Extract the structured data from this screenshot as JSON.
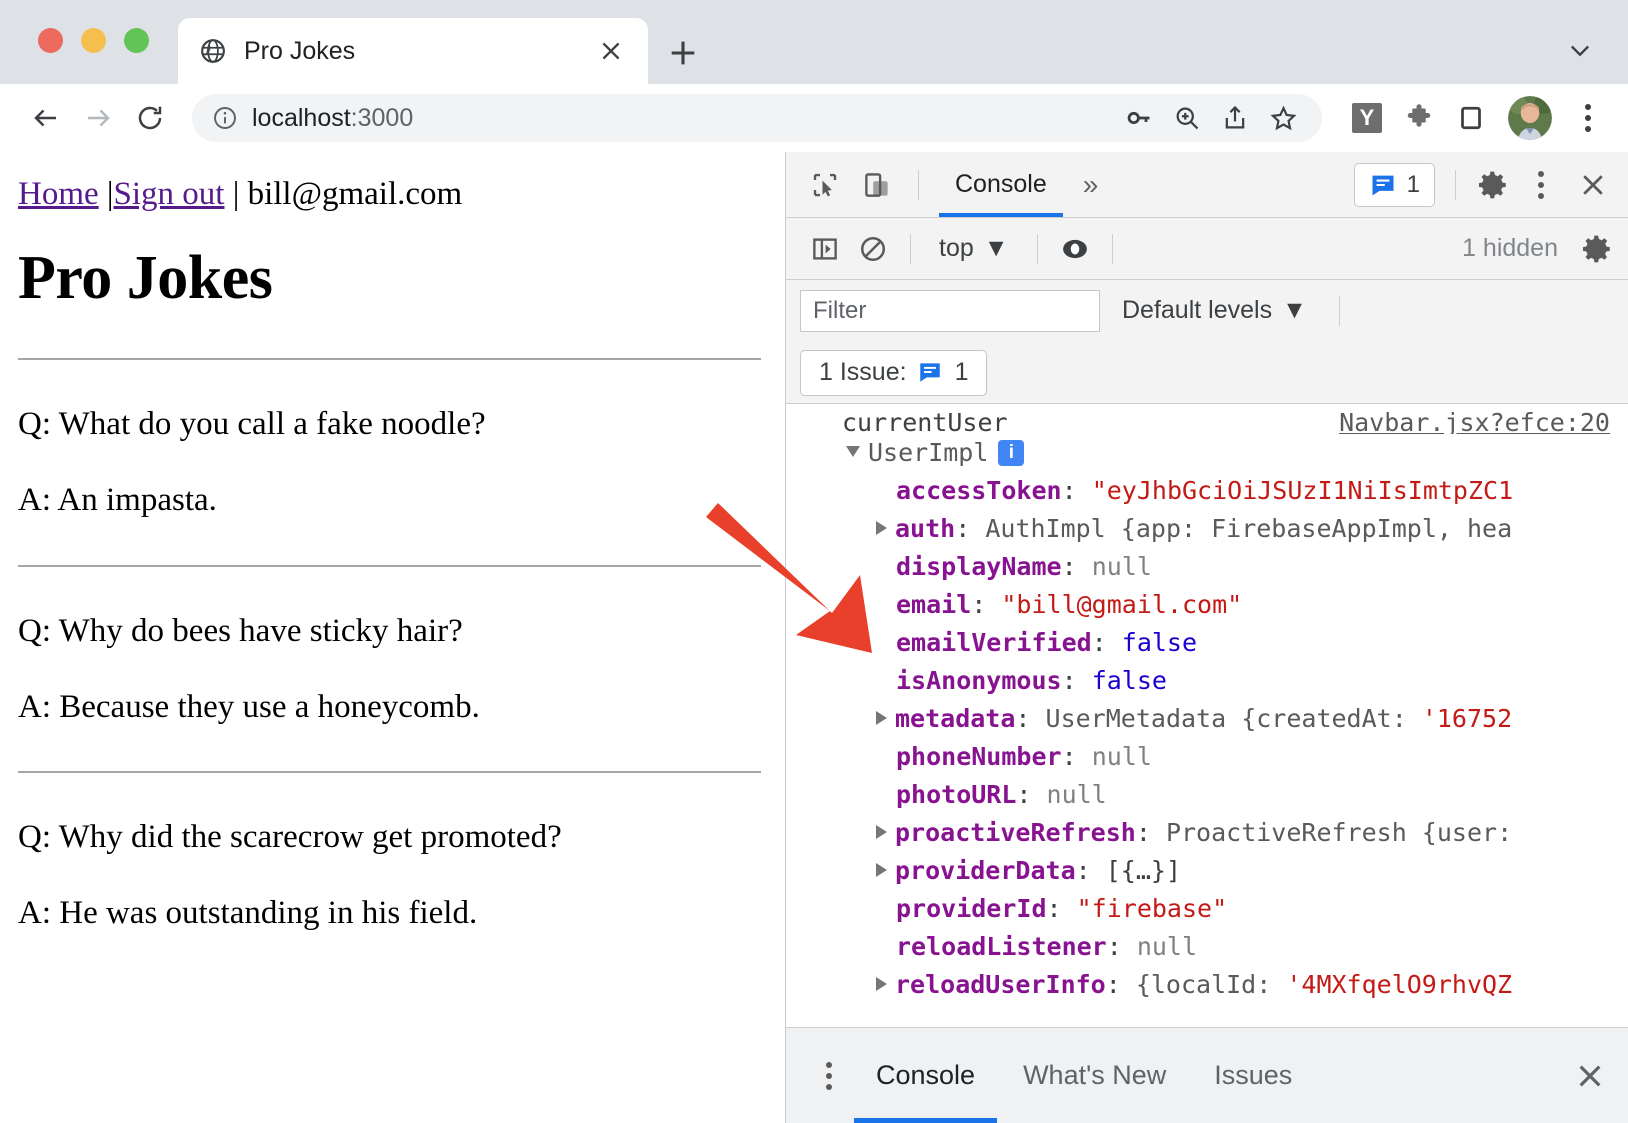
{
  "browser": {
    "tab": {
      "title": "Pro Jokes",
      "favicon": "globe-icon",
      "close": "×"
    },
    "new_tab_label": "+",
    "url": {
      "scheme_host": "localhost",
      "port": ":3000"
    },
    "toolbar_icons": [
      "key-icon",
      "zoom-icon",
      "share-icon",
      "bookmark-star-icon",
      "y-extension-icon",
      "puzzle-extension-icon",
      "sidebar-icon",
      "avatar"
    ],
    "y_badge": "Y"
  },
  "page": {
    "nav": {
      "home": "Home",
      "pipe1": " |",
      "signout": "Sign out",
      "pipe2": " | ",
      "email": "bill@gmail.com"
    },
    "title": "Pro Jokes",
    "jokes": [
      {
        "q": "Q: What do you call a fake noodle?",
        "a": "A: An impasta."
      },
      {
        "q": "Q: Why do bees have sticky hair?",
        "a": "A: Because they use a honeycomb."
      },
      {
        "q": "Q: Why did the scarecrow get promoted?",
        "a": "A: He was outstanding in his field."
      }
    ]
  },
  "devtools": {
    "header": {
      "inspect_icon": "inspect-cursor-icon",
      "device_icon": "device-toolbar-icon",
      "tabs": [
        {
          "label": "Console",
          "active": true
        }
      ],
      "more_tabs": "»",
      "issue_badge_count": "1",
      "settings_icon": "gear-icon",
      "menu_icon": "kebab-menu-icon",
      "close_icon": "×"
    },
    "toolbar": {
      "sidebar_icon": "console-sidebar-icon",
      "clear_icon": "clear-console-icon",
      "context": "top",
      "eye_icon": "live-expression-icon",
      "hidden_label": "1 hidden",
      "settings_icon": "gear-icon"
    },
    "filterbar": {
      "filter_placeholder": "Filter",
      "filter_value": "",
      "levels": "Default levels"
    },
    "issues_bar": {
      "label": "1 Issue:",
      "count": "1"
    },
    "console": {
      "source_link": "Navbar.jsx?efce:20",
      "first_line": "currentUser",
      "object_name": "UserImpl",
      "info_badge": "i",
      "properties": [
        {
          "expandable": false,
          "name": "accessToken",
          "sep": ": ",
          "value": "\"eyJhbGciOiJSUzI1NiIsImtpZC1",
          "vtype": "str"
        },
        {
          "expandable": true,
          "name": "auth",
          "sep": ": ",
          "value": "AuthImpl {app: FirebaseAppImpl, hea",
          "vtype": "cls"
        },
        {
          "expandable": false,
          "name": "displayName",
          "sep": ": ",
          "value": "null",
          "vtype": "nul"
        },
        {
          "expandable": false,
          "name": "email",
          "sep": ": ",
          "value": "\"bill@gmail.com\"",
          "vtype": "str"
        },
        {
          "expandable": false,
          "name": "emailVerified",
          "sep": ": ",
          "value": "false",
          "vtype": "kw"
        },
        {
          "expandable": false,
          "name": "isAnonymous",
          "sep": ": ",
          "value": "false",
          "vtype": "kw"
        },
        {
          "expandable": true,
          "name": "metadata",
          "sep": ": ",
          "value": "UserMetadata {createdAt: '16752",
          "vtype": "mixed-meta"
        },
        {
          "expandable": false,
          "name": "phoneNumber",
          "sep": ": ",
          "value": "null",
          "vtype": "nul"
        },
        {
          "expandable": false,
          "name": "photoURL",
          "sep": ": ",
          "value": "null",
          "vtype": "nul"
        },
        {
          "expandable": true,
          "name": "proactiveRefresh",
          "sep": ": ",
          "value": "ProactiveRefresh {user:",
          "vtype": "cls"
        },
        {
          "expandable": true,
          "name": "providerData",
          "sep": ": ",
          "value": "[{…}]",
          "vtype": "punct"
        },
        {
          "expandable": false,
          "name": "providerId",
          "sep": ": ",
          "value": "\"firebase\"",
          "vtype": "str"
        },
        {
          "expandable": false,
          "name": "reloadListener",
          "sep": ": ",
          "value": "null",
          "vtype": "nul"
        },
        {
          "expandable": true,
          "name": "reloadUserInfo",
          "sep": ": ",
          "value": "{localId: '4MXfqelO9rhvQZ",
          "vtype": "mixed-local"
        }
      ]
    },
    "drawer": {
      "menu_icon": "kebab-menu-icon",
      "tabs": [
        {
          "label": "Console",
          "active": true
        },
        {
          "label": "What's New",
          "active": false
        },
        {
          "label": "Issues",
          "active": false
        }
      ],
      "close": "×"
    }
  },
  "annotation": {
    "arrow_color": "#e8402a",
    "shape": "arrow-pointing-down-right"
  },
  "colors": {
    "accent_blue": "#1a73e8",
    "link_purple": "#551a8b",
    "prop_purple": "#881391",
    "string_red": "#c41a16",
    "keyword_blue": "#1c00cf"
  }
}
